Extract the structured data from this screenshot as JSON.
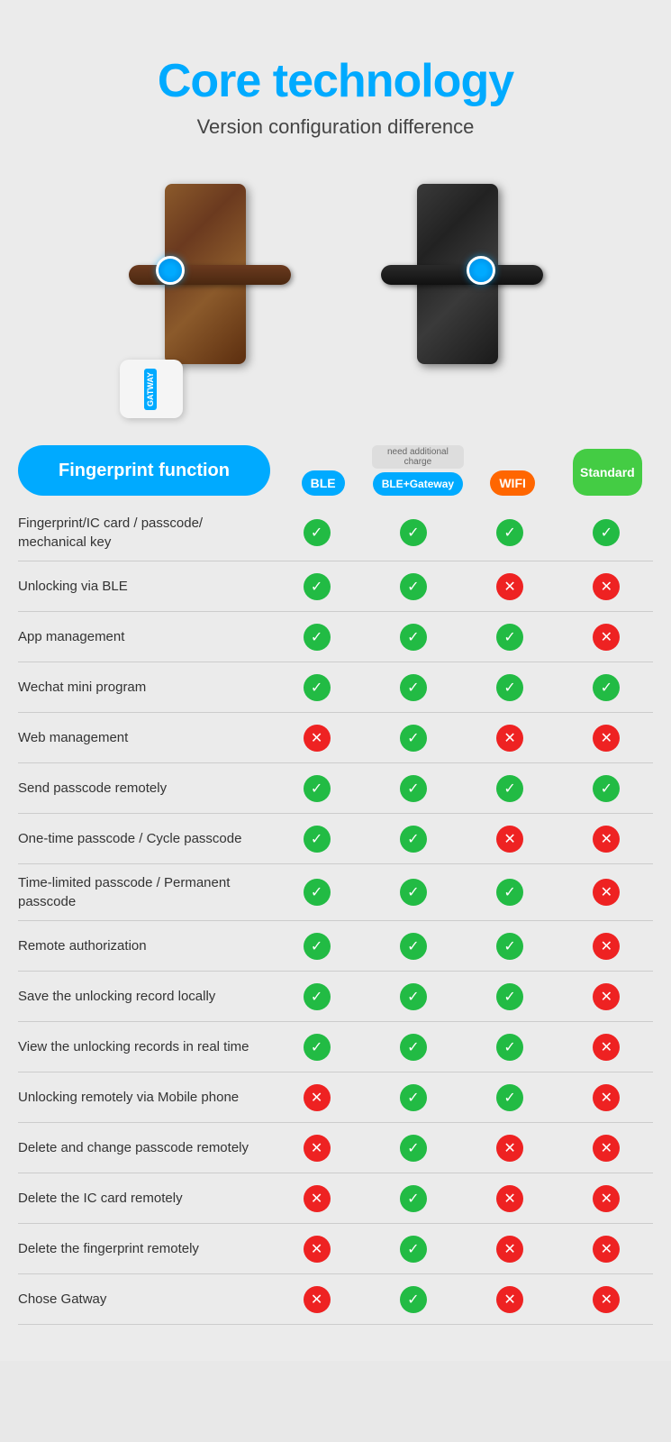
{
  "page": {
    "title": "Core technology",
    "subtitle": "Version configuration difference"
  },
  "columns": {
    "feature_label": "Fingerprint function",
    "col1": "BLE",
    "col2": "BLE+Gateway",
    "col3": "WIFI",
    "col4": "Standard",
    "additional_charge": "need additional charge"
  },
  "gateway": {
    "label": "GATWAY"
  },
  "rows": [
    {
      "feature": "Fingerprint/IC card / passcode/ mechanical key",
      "ble": true,
      "ble_gateway": true,
      "wifi": true,
      "standard": true
    },
    {
      "feature": "Unlocking via BLE",
      "ble": true,
      "ble_gateway": true,
      "wifi": false,
      "standard": false
    },
    {
      "feature": "App management",
      "ble": true,
      "ble_gateway": true,
      "wifi": true,
      "standard": false
    },
    {
      "feature": "Wechat mini program",
      "ble": true,
      "ble_gateway": true,
      "wifi": true,
      "standard": true
    },
    {
      "feature": "Web management",
      "ble": false,
      "ble_gateway": true,
      "wifi": false,
      "standard": false
    },
    {
      "feature": "Send passcode remotely",
      "ble": true,
      "ble_gateway": true,
      "wifi": true,
      "standard": true
    },
    {
      "feature": "One-time passcode / Cycle passcode",
      "ble": true,
      "ble_gateway": true,
      "wifi": false,
      "standard": false
    },
    {
      "feature": "Time-limited passcode / Permanent passcode",
      "ble": true,
      "ble_gateway": true,
      "wifi": true,
      "standard": false
    },
    {
      "feature": "Remote authorization",
      "ble": true,
      "ble_gateway": true,
      "wifi": true,
      "standard": false
    },
    {
      "feature": "Save the unlocking record locally",
      "ble": true,
      "ble_gateway": true,
      "wifi": true,
      "standard": false
    },
    {
      "feature": "View the unlocking records in real time",
      "ble": true,
      "ble_gateway": true,
      "wifi": true,
      "standard": false
    },
    {
      "feature": "Unlocking remotely via Mobile phone",
      "ble": false,
      "ble_gateway": true,
      "wifi": true,
      "standard": false
    },
    {
      "feature": "Delete and change passcode remotely",
      "ble": false,
      "ble_gateway": true,
      "wifi": false,
      "standard": false
    },
    {
      "feature": "Delete the IC card remotely",
      "ble": false,
      "ble_gateway": true,
      "wifi": false,
      "standard": false
    },
    {
      "feature": "Delete the fingerprint remotely",
      "ble": false,
      "ble_gateway": true,
      "wifi": false,
      "standard": false
    },
    {
      "feature": "Chose Gatway",
      "ble": false,
      "ble_gateway": true,
      "wifi": false,
      "standard": false
    }
  ]
}
